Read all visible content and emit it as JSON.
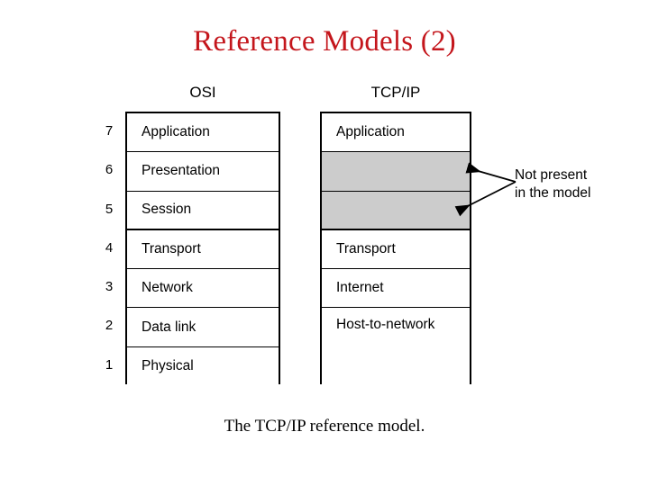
{
  "slide": {
    "title": "Reference Models (2)",
    "title_color": "#c4161c",
    "caption": "The TCP/IP reference model."
  },
  "osi_column": {
    "header": "OSI",
    "layers": [
      {
        "number": "7",
        "label": "Application"
      },
      {
        "number": "6",
        "label": "Presentation"
      },
      {
        "number": "5",
        "label": "Session"
      },
      {
        "number": "4",
        "label": "Transport"
      },
      {
        "number": "3",
        "label": "Network"
      },
      {
        "number": "2",
        "label": "Data link"
      },
      {
        "number": "1",
        "label": "Physical"
      }
    ]
  },
  "tcpip_column": {
    "header": "TCP/IP",
    "layers": [
      {
        "label": "Application",
        "filled": false
      },
      {
        "label": "",
        "filled": true
      },
      {
        "label": "",
        "filled": true
      },
      {
        "label": "Transport",
        "filled": false
      },
      {
        "label": "Internet",
        "filled": false
      },
      {
        "label": "Host-to-network",
        "filled": false
      }
    ],
    "empty_fill_color": "#cccccc"
  },
  "annotation": {
    "line1": "Not present",
    "line2": "in the model"
  }
}
